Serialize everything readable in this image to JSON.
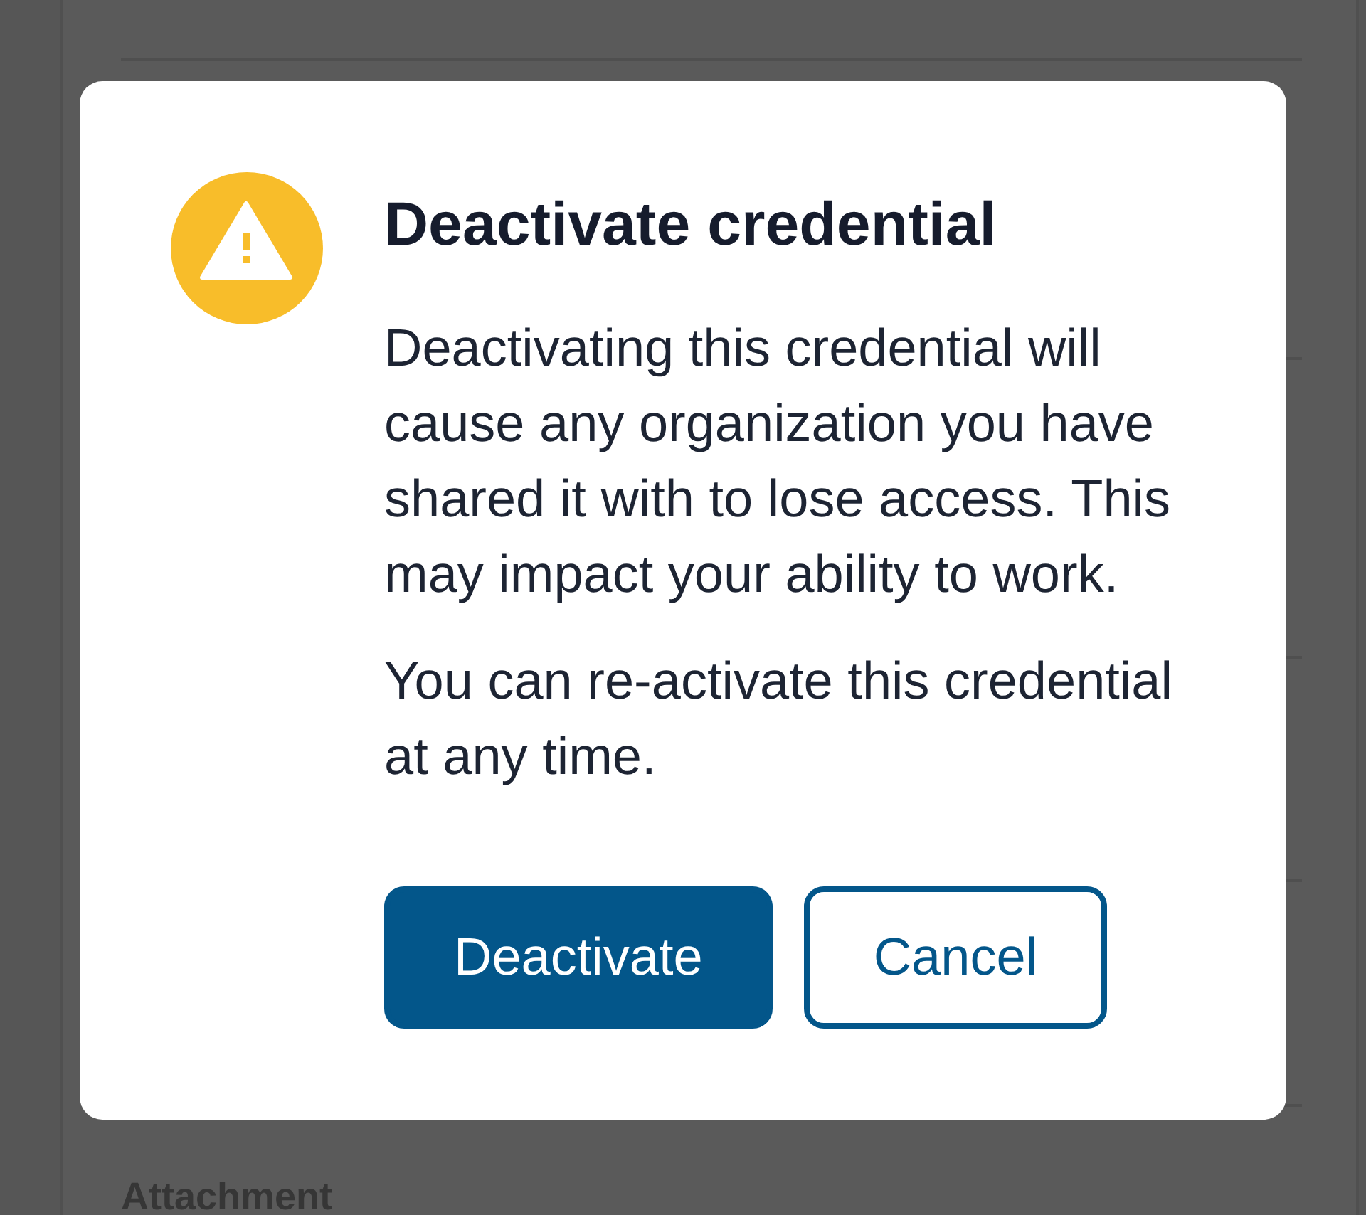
{
  "page": {
    "section_heading": "Attachment"
  },
  "dialog": {
    "title": "Deactivate credential",
    "paragraphs": [
      "Deactivating this credential will cause any organization you have shared it with to lose access. This may impact your ability to work.",
      "You can re-activate this credential at any time."
    ],
    "buttons": [
      {
        "label": "Deactivate",
        "kind": "primary"
      },
      {
        "label": "Cancel",
        "kind": "secondary"
      }
    ]
  }
}
